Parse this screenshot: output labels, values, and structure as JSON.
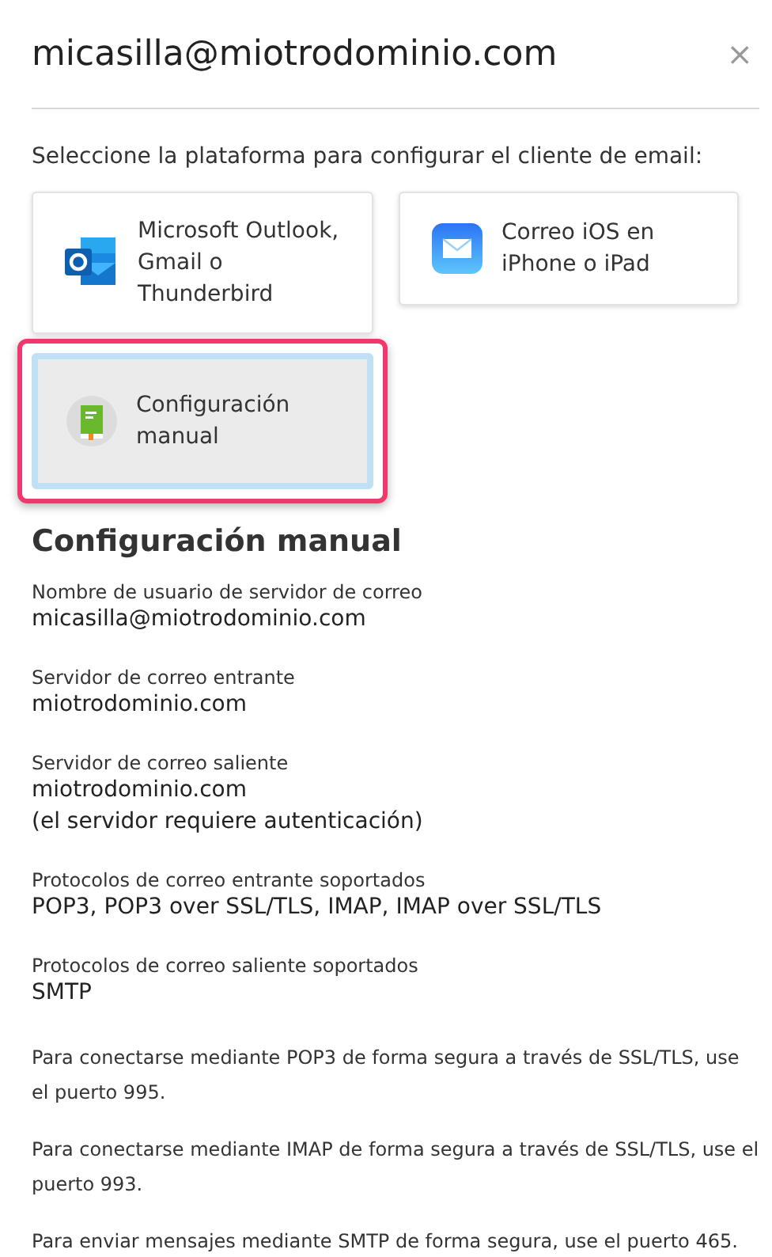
{
  "dialog": {
    "title": "micasilla@miotrodominio.com",
    "close": "×"
  },
  "prompt": "Seleccione la plataforma para configurar el cliente de email:",
  "platforms": [
    {
      "kind": "outlook",
      "label": "Microsoft Outlook, Gmail o Thunderbird",
      "selected": false,
      "highlighted": false
    },
    {
      "kind": "ios",
      "label": "Correo iOS en iPhone o iPad",
      "selected": false,
      "highlighted": false
    },
    {
      "kind": "manual",
      "label": "Configuración manual",
      "selected": true,
      "highlighted": true
    }
  ],
  "section": {
    "heading": "Configuración manual",
    "fields": [
      {
        "label": "Nombre de usuario de servidor de correo",
        "values": [
          "micasilla@miotrodominio.com"
        ]
      },
      {
        "label": "Servidor de correo entrante",
        "values": [
          "miotrodominio.com"
        ]
      },
      {
        "label": "Servidor de correo saliente",
        "values": [
          "miotrodominio.com",
          "(el servidor requiere autenticación)"
        ]
      },
      {
        "label": "Protocolos de correo entrante soportados",
        "values": [
          "POP3, POP3 over SSL/TLS, IMAP, IMAP over SSL/TLS"
        ]
      },
      {
        "label": "Protocolos de correo saliente soportados",
        "values": [
          "SMTP"
        ]
      }
    ],
    "notes": [
      "Para conectarse mediante POP3 de forma segura a través de SSL/TLS, use el puerto 995.",
      "Para conectarse mediante IMAP de forma segura a través de SSL/TLS, use el puerto 993.",
      "Para enviar mensajes mediante SMTP de forma segura, use el puerto 465."
    ]
  }
}
